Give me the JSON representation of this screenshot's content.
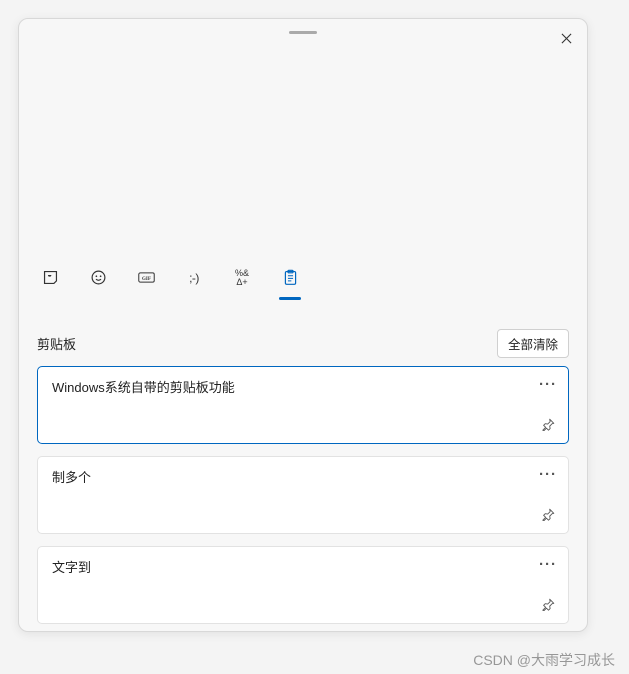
{
  "tabs": {
    "kaomoji_label": ";-)",
    "symbols_line1": "%&",
    "symbols_line2": "Δ+"
  },
  "section": {
    "title": "剪贴板",
    "clear_all": "全部清除"
  },
  "clips": [
    {
      "text": "Windows系统自带的剪贴板功能",
      "selected": true
    },
    {
      "text": "制多个",
      "selected": false
    },
    {
      "text": "文字到",
      "selected": false
    }
  ],
  "watermark": "CSDN @大雨学习成长"
}
